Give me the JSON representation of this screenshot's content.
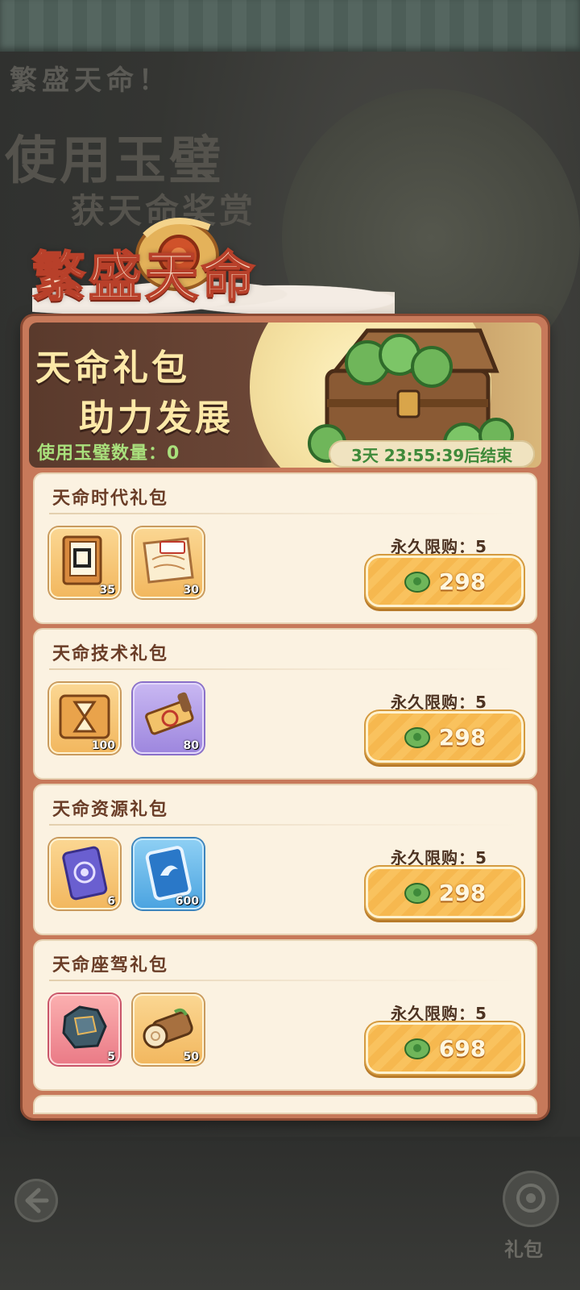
{
  "background": {
    "faint_title": "繁盛天命！",
    "faint_line1": "使用玉璧",
    "faint_line2": "获天命奖赏"
  },
  "main_title": "繁盛天命",
  "banner": {
    "title_line1": "天命礼包",
    "title_line2": "助力发展",
    "jade_count_label": "使用玉璧数量：0",
    "timer": "3天 23:55:39后结束"
  },
  "packages": [
    {
      "title": "天命时代礼包",
      "items": [
        {
          "icon": "book-icon",
          "qty": "35",
          "frame": "gold"
        },
        {
          "icon": "map-scroll-icon",
          "qty": "30",
          "frame": "gold"
        }
      ],
      "limit": "永久限购：5",
      "price": "298"
    },
    {
      "title": "天命技术礼包",
      "items": [
        {
          "icon": "hourglass-card-icon",
          "qty": "100",
          "frame": "gold"
        },
        {
          "icon": "tech-scroll-icon",
          "qty": "80",
          "frame": "purple"
        }
      ],
      "limit": "永久限购：5",
      "price": "298"
    },
    {
      "title": "天命资源礼包",
      "items": [
        {
          "icon": "purple-card-icon",
          "qty": "6",
          "frame": "gold"
        },
        {
          "icon": "blue-card-icon",
          "qty": "600",
          "frame": "blue"
        }
      ],
      "limit": "永久限购：5",
      "price": "298"
    },
    {
      "title": "天命座驾礼包",
      "items": [
        {
          "icon": "armor-icon",
          "qty": "5",
          "frame": "red"
        },
        {
          "icon": "wood-log-icon",
          "qty": "50",
          "frame": "gold"
        }
      ],
      "limit": "永久限购：5",
      "price": "698"
    }
  ],
  "bottom": {
    "gift_label": "礼包"
  },
  "colors": {
    "accent_green": "#a9e07c",
    "button_orange": "#f6b84f",
    "panel_brown": "#c7795a"
  }
}
